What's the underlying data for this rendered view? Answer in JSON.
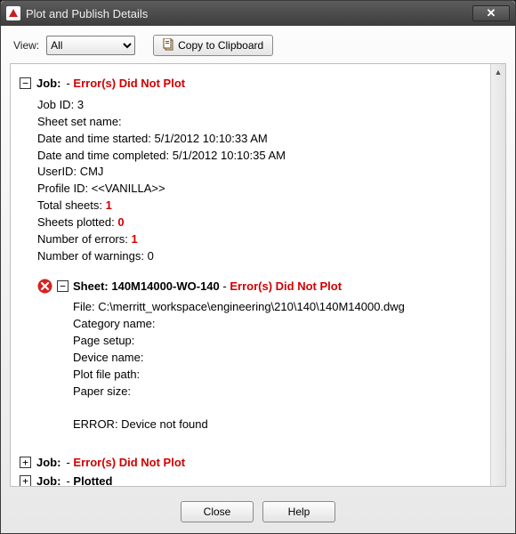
{
  "window": {
    "title": "Plot and Publish Details"
  },
  "toolbar": {
    "view_label": "View:",
    "view_value": "All",
    "copy_label": "Copy to Clipboard"
  },
  "jobs": [
    {
      "expanded": true,
      "label": "Job:",
      "status_prefix": "-",
      "status": "Error(s) Did Not Plot",
      "details": {
        "job_id_label": "Job ID:",
        "job_id": "3",
        "sheet_set_label": "Sheet set name:",
        "sheet_set": "",
        "start_label": "Date and time started:",
        "start": "5/1/2012 10:10:33 AM",
        "complete_label": "Date and time completed:",
        "complete": "5/1/2012 10:10:35 AM",
        "userid_label": "UserID:",
        "userid": "CMJ",
        "profile_label": "Profile ID:",
        "profile": "<<VANILLA>>",
        "total_sheets_label": "Total sheets:",
        "total_sheets": "1",
        "plotted_label": "Sheets plotted:",
        "plotted": "0",
        "errors_label": "Number of errors:",
        "errors": "1",
        "warnings_label": "Number of warnings:",
        "warnings": "0"
      },
      "sheets": [
        {
          "expanded": true,
          "label": "Sheet:",
          "name": "140M14000-WO-140",
          "status_prefix": "-",
          "status": "Error(s) Did Not Plot",
          "file_label": "File:",
          "file": "C:\\merritt_workspace\\engineering\\210\\140\\140M14000.dwg",
          "category_label": "Category name:",
          "page_setup_label": "Page setup:",
          "device_label": "Device name:",
          "plot_path_label": "Plot file path:",
          "paper_label": "Paper size:",
          "error_msg": "ERROR: Device not found"
        }
      ]
    },
    {
      "expanded": false,
      "label": "Job:",
      "status_prefix": "-",
      "status": "Error(s) Did Not Plot"
    },
    {
      "expanded": false,
      "label": "Job:",
      "status_prefix": "-",
      "status": "Plotted",
      "status_ok": true
    }
  ],
  "buttons": {
    "close": "Close",
    "help": "Help"
  }
}
